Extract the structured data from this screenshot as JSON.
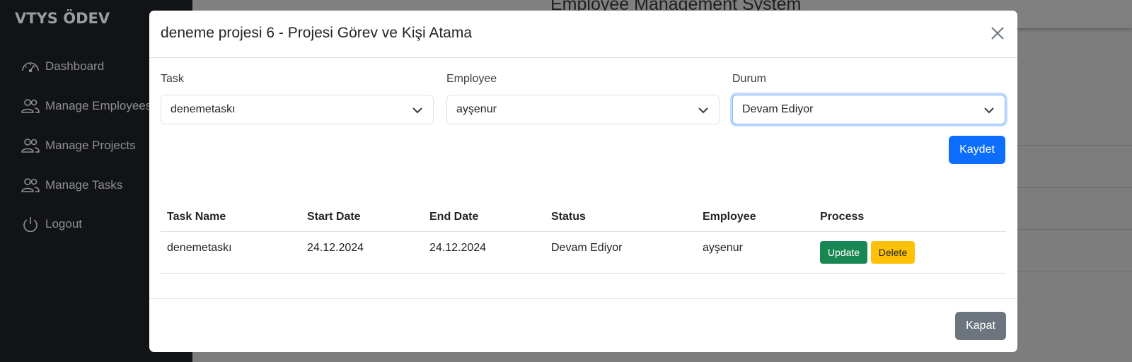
{
  "app": {
    "brand": "VTYS ÖDEV",
    "title": "Employee Management System"
  },
  "sidebar": {
    "items": [
      {
        "label": "Dashboard",
        "icon": "speedometer-icon"
      },
      {
        "label": "Manage Employees",
        "icon": "people-icon"
      },
      {
        "label": "Manage Projects",
        "icon": "people-icon"
      },
      {
        "label": "Manage Tasks",
        "icon": "people-icon"
      },
      {
        "label": "Logout",
        "icon": "power-icon"
      }
    ]
  },
  "modal": {
    "title": "deneme projesi 6 - Projesi Görev ve Kişi Atama",
    "form": {
      "task": {
        "label": "Task",
        "value": "denemetaskı"
      },
      "employee": {
        "label": "Employee",
        "value": "ayşenur"
      },
      "status": {
        "label": "Durum",
        "value": "Devam Ediyor"
      }
    },
    "save_label": "Kaydet",
    "table": {
      "headers": [
        "Task Name",
        "Start Date",
        "End Date",
        "Status",
        "Employee",
        "Process"
      ],
      "rows": [
        {
          "task_name": "denemetaskı",
          "start_date": "24.12.2024",
          "end_date": "24.12.2024",
          "status": "Devam Ediyor",
          "employee": "ayşenur",
          "update_label": "Update",
          "delete_label": "Delete"
        }
      ]
    },
    "close_label": "Kapat"
  },
  "colors": {
    "primary": "#0d6efd",
    "success": "#198754",
    "warning": "#ffc107",
    "secondary": "#6c757d",
    "sidebar_bg": "#121316"
  }
}
